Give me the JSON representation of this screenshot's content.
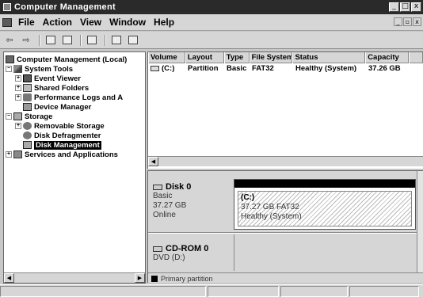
{
  "window": {
    "title": "Computer Management"
  },
  "menu": {
    "items": [
      "File",
      "Action",
      "View",
      "Window",
      "Help"
    ]
  },
  "toolbar": {
    "icons": [
      "back-arrow-icon",
      "forward-arrow-icon",
      "up-folder-icon",
      "show-hide-tree-icon",
      "properties-icon",
      "help-icon",
      "refresh-icon"
    ]
  },
  "tree": {
    "root": "Computer Management (Local)",
    "system_tools": "System Tools",
    "event_viewer": "Event Viewer",
    "shared_folders": "Shared Folders",
    "perf_logs": "Performance Logs and A",
    "device_manager": "Device Manager",
    "storage": "Storage",
    "removable_storage": "Removable Storage",
    "disk_defrag": "Disk Defragmenter",
    "disk_management": "Disk Management",
    "services": "Services and Applications"
  },
  "volume_list": {
    "columns": [
      "Volume",
      "Layout",
      "Type",
      "File System",
      "Status",
      "Capacity"
    ],
    "rows": [
      {
        "volume": "(C:)",
        "layout": "Partition",
        "type": "Basic",
        "fs": "FAT32",
        "status": "Healthy (System)",
        "capacity": "37.26 GB"
      }
    ]
  },
  "disks": [
    {
      "name": "Disk 0",
      "type": "Basic",
      "size": "37.27 GB",
      "state": "Online",
      "partition": {
        "label": "(C:)",
        "size_fs": "37.27 GB FAT32",
        "status": "Healthy (System)"
      }
    },
    {
      "name": "CD-ROM 0",
      "type": "DVD (D:)"
    }
  ],
  "legend": {
    "primary": "Primary partition"
  }
}
